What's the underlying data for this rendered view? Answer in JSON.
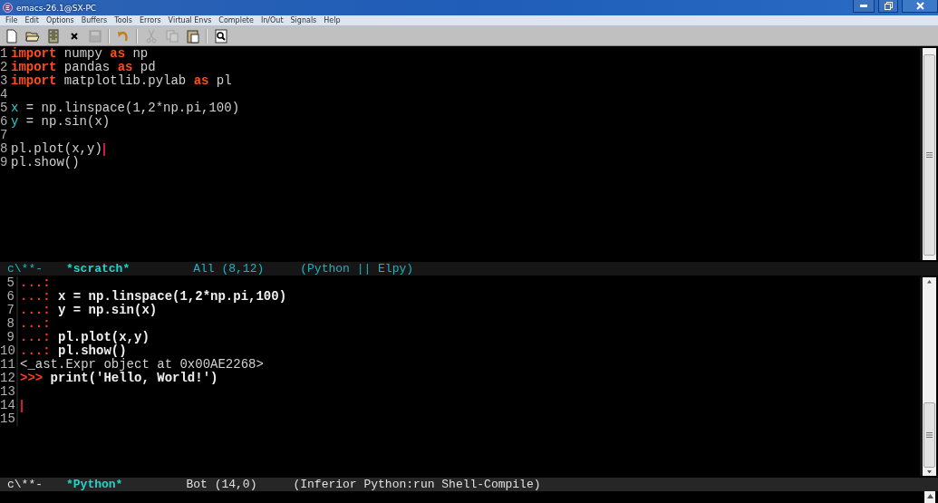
{
  "window": {
    "title": "emacs-26.1@SX-PC"
  },
  "menu": [
    "File",
    "Edit",
    "Options",
    "Buffers",
    "Tools",
    "Errors",
    "Virtual Envs",
    "Complete",
    "In/Out",
    "Signals",
    "Help"
  ],
  "toolbar": [
    {
      "kind": "new",
      "disabled": false
    },
    {
      "kind": "open",
      "disabled": false
    },
    {
      "kind": "dired",
      "disabled": false
    },
    {
      "kind": "close",
      "disabled": false
    },
    {
      "kind": "save",
      "disabled": true
    },
    {
      "kind": "separator"
    },
    {
      "kind": "undo",
      "disabled": false
    },
    {
      "kind": "separator"
    },
    {
      "kind": "cut",
      "disabled": true
    },
    {
      "kind": "copy",
      "disabled": true
    },
    {
      "kind": "paste",
      "disabled": false
    },
    {
      "kind": "separator"
    },
    {
      "kind": "search",
      "disabled": false
    }
  ],
  "top_pane": {
    "lines": [
      {
        "number": "1",
        "cursor": false,
        "segments": [
          {
            "kind": "keyword",
            "text": "import"
          },
          {
            "kind": "plain",
            "text": " numpy "
          },
          {
            "kind": "keyword",
            "text": "as"
          },
          {
            "kind": "plain",
            "text": " np"
          }
        ]
      },
      {
        "number": "2",
        "cursor": false,
        "segments": [
          {
            "kind": "keyword",
            "text": "import"
          },
          {
            "kind": "plain",
            "text": " pandas "
          },
          {
            "kind": "keyword",
            "text": "as"
          },
          {
            "kind": "plain",
            "text": " pd"
          }
        ]
      },
      {
        "number": "3",
        "cursor": false,
        "segments": [
          {
            "kind": "keyword",
            "text": "import"
          },
          {
            "kind": "plain",
            "text": " matplotlib.pylab "
          },
          {
            "kind": "keyword",
            "text": "as"
          },
          {
            "kind": "plain",
            "text": " pl"
          }
        ]
      },
      {
        "number": "4",
        "cursor": false
      },
      {
        "number": "5",
        "cursor": false,
        "segments": [
          {
            "kind": "variable",
            "text": "x"
          },
          {
            "kind": "plain",
            "text": " = np.linspace(1,2*np.pi,100)"
          }
        ]
      },
      {
        "number": "6",
        "cursor": false,
        "segments": [
          {
            "kind": "variable",
            "text": "y"
          },
          {
            "kind": "plain",
            "text": " = np.sin(x)"
          }
        ]
      },
      {
        "number": "7",
        "cursor": false
      },
      {
        "number": "8",
        "cursor": true,
        "segments": [
          {
            "kind": "plain",
            "text": "pl.plot(x,y)"
          }
        ]
      },
      {
        "number": "9",
        "cursor": false,
        "segments": [
          {
            "kind": "plain",
            "text": "pl.show()"
          }
        ]
      }
    ]
  },
  "top_mode_line": {
    "active": false,
    "status": "c\\**-",
    "buffer": "*scratch*",
    "position": "All (8,12)",
    "mode": "(Python || Elpy)"
  },
  "bottom_pane": {
    "lines": [
      {
        "number": "5",
        "cursor": false,
        "segments": [
          {
            "kind": "prompt",
            "text": "...:"
          }
        ]
      },
      {
        "number": "6",
        "cursor": false,
        "segments": [
          {
            "kind": "prompt",
            "text": "...:"
          },
          {
            "kind": "input",
            "text": " x = np.linspace(1,2*np.pi,100)"
          }
        ]
      },
      {
        "number": "7",
        "cursor": false,
        "segments": [
          {
            "kind": "prompt",
            "text": "...:"
          },
          {
            "kind": "input",
            "text": " y = np.sin(x)"
          }
        ]
      },
      {
        "number": "8",
        "cursor": false,
        "segments": [
          {
            "kind": "prompt",
            "text": "...:"
          }
        ]
      },
      {
        "number": "9",
        "cursor": false,
        "segments": [
          {
            "kind": "prompt",
            "text": "...:"
          },
          {
            "kind": "input",
            "text": " pl.plot(x,y)"
          }
        ]
      },
      {
        "number": "10",
        "cursor": false,
        "segments": [
          {
            "kind": "prompt",
            "text": "...:"
          },
          {
            "kind": "input",
            "text": " pl.show()"
          }
        ]
      },
      {
        "number": "11",
        "cursor": false,
        "segments": [
          {
            "kind": "plain",
            "text": "<_ast.Expr object at 0x00AE2268>"
          }
        ]
      },
      {
        "number": "12",
        "cursor": false,
        "segments": [
          {
            "kind": "prompt",
            "text": ">>>"
          },
          {
            "kind": "input",
            "text": " print('Hello, World!')"
          }
        ]
      },
      {
        "number": "13",
        "cursor": false
      },
      {
        "number": "14",
        "cursor": true
      },
      {
        "number": "15",
        "cursor": false
      }
    ]
  },
  "bottom_mode_line": {
    "active": true,
    "status": "c\\**-",
    "buffer": "*Python*",
    "position": "Bot (14,0)",
    "mode": "(Inferior Python:run Shell-Compile)"
  }
}
